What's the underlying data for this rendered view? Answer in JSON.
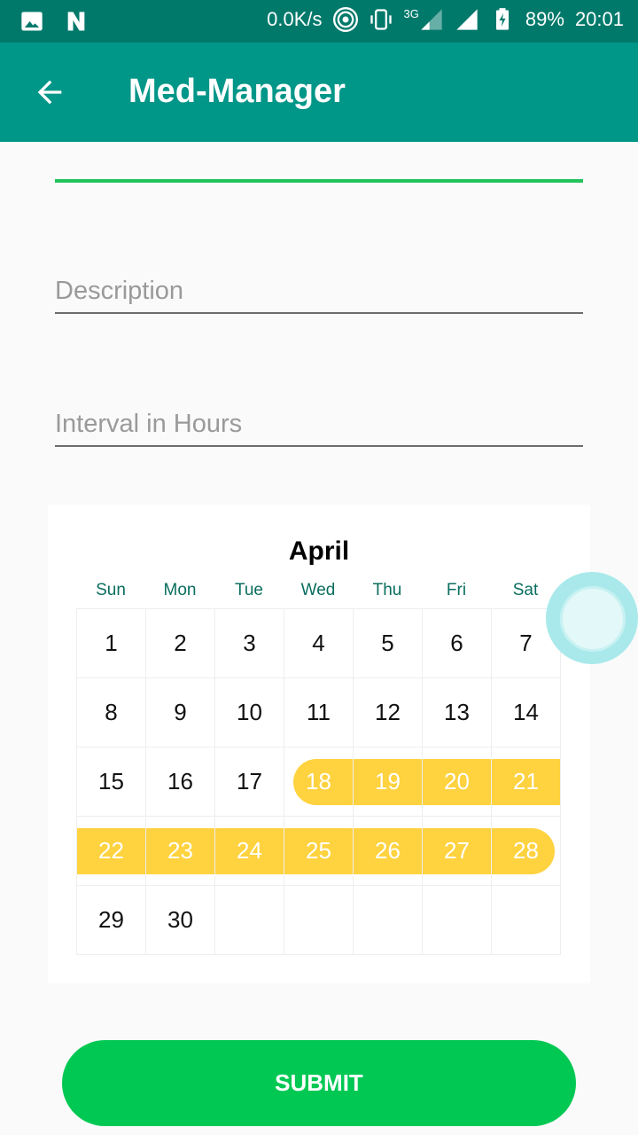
{
  "status_bar": {
    "net_speed": "0.0K/s",
    "network_type": "3G",
    "battery": "89%",
    "time": "20:01",
    "icons": [
      "image-icon",
      "n-icon",
      "hotspot-icon",
      "vibrate-icon",
      "signal-icon",
      "signal-icon",
      "battery-charging-icon"
    ]
  },
  "app_bar": {
    "title": "Med-Manager",
    "back_icon": "arrow-left-icon"
  },
  "form": {
    "name_value": "",
    "description_placeholder": "Description",
    "interval_placeholder": "Interval in Hours"
  },
  "calendar": {
    "month": "April",
    "weekdays": [
      "Sun",
      "Mon",
      "Tue",
      "Wed",
      "Thu",
      "Fri",
      "Sat"
    ],
    "weeks": [
      [
        "1",
        "2",
        "3",
        "4",
        "5",
        "6",
        "7"
      ],
      [
        "8",
        "9",
        "10",
        "11",
        "12",
        "13",
        "14"
      ],
      [
        "15",
        "16",
        "17",
        "18",
        "19",
        "20",
        "21"
      ],
      [
        "22",
        "23",
        "24",
        "25",
        "26",
        "27",
        "28"
      ],
      [
        "29",
        "30",
        "",
        "",
        "",
        "",
        ""
      ]
    ],
    "selected_range": {
      "start": 18,
      "end": 28
    },
    "highlight_color": "#ffd23f"
  },
  "submit_label": "SUBMIT",
  "colors": {
    "app_bar": "#009688",
    "status_bar": "#00796b",
    "accent": "#00c853"
  }
}
